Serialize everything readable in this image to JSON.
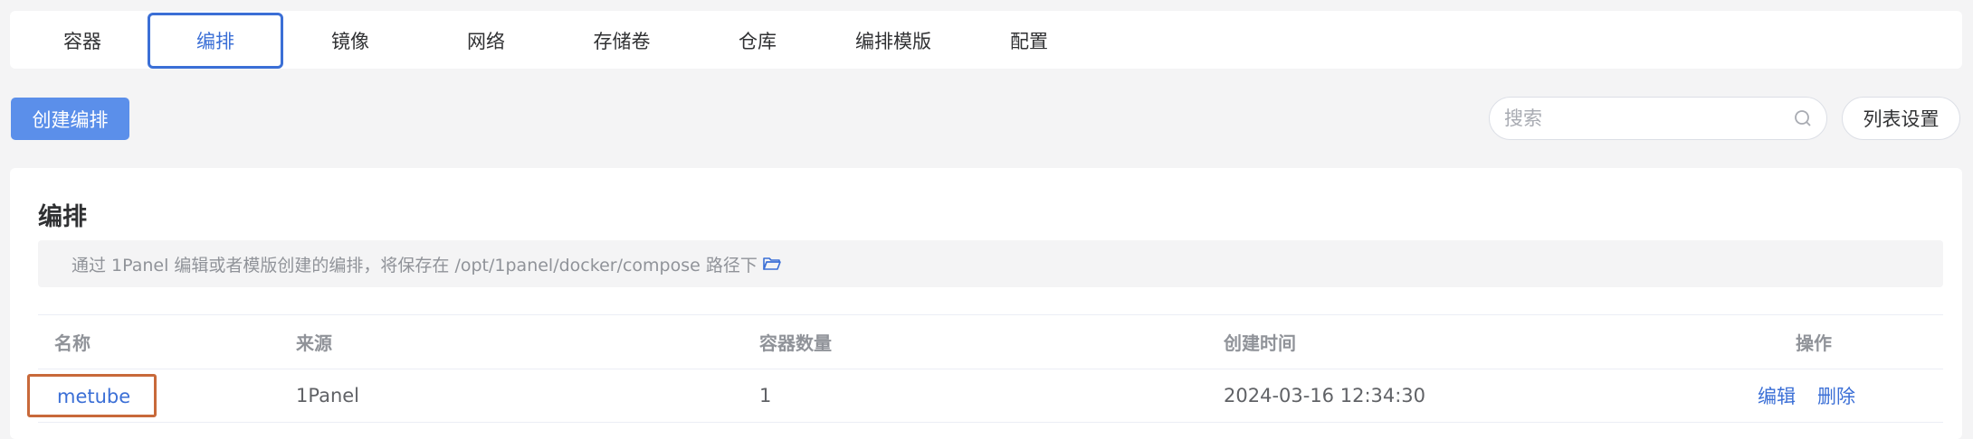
{
  "tabs": [
    {
      "label": "容器",
      "active": false
    },
    {
      "label": "编排",
      "active": true
    },
    {
      "label": "镜像",
      "active": false
    },
    {
      "label": "网络",
      "active": false
    },
    {
      "label": "存储卷",
      "active": false
    },
    {
      "label": "仓库",
      "active": false
    },
    {
      "label": "编排模版",
      "active": false
    },
    {
      "label": "配置",
      "active": false
    }
  ],
  "toolbar": {
    "create_label": "创建编排",
    "search_placeholder": "搜索",
    "list_settings_label": "列表设置"
  },
  "panel": {
    "title": "编排",
    "notice": "通过 1Panel 编辑或者模版创建的编排，将保存在 /opt/1panel/docker/compose 路径下"
  },
  "table": {
    "columns": [
      "名称",
      "来源",
      "容器数量",
      "创建时间",
      "操作"
    ],
    "rows": [
      {
        "name": "metube",
        "source": "1Panel",
        "count": "1",
        "created": "2024-03-16 12:34:30",
        "ops": [
          "编辑",
          "删除"
        ]
      }
    ]
  },
  "colors": {
    "accent": "#3b6fd6",
    "button": "#5b8fea",
    "highlight": "#c8693a"
  }
}
